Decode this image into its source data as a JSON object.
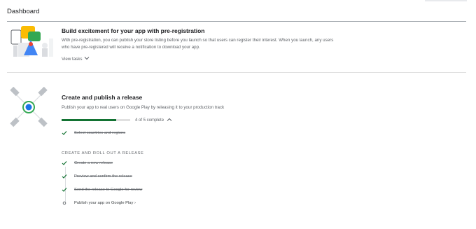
{
  "header": {
    "title": "Dashboard"
  },
  "cards": [
    {
      "title": "Build excitement for your app with pre-registration",
      "description": "With pre-registration, you can publish your store listing before you launch so that users can register their interest. When you launch, any users who have pre-registered will receive a notification to download your app.",
      "link_label": "View tasks"
    },
    {
      "title": "Create and publish a release",
      "description": "Publish your app to real users on Google Play by releasing it to your production track",
      "progress": {
        "completed": 4,
        "total": 5,
        "label": "4 of 5 complete"
      },
      "tasks_top": [
        {
          "label": "Select countries and regions",
          "done": true
        }
      ],
      "group_heading": "CREATE AND ROLL OUT A RELEASE",
      "tasks": [
        {
          "label": "Create a new release",
          "done": true
        },
        {
          "label": "Preview and confirm the release",
          "done": true
        },
        {
          "label": "Send the release to Google for review",
          "done": true
        },
        {
          "label": "Publish your app on Google Play ›",
          "done": false
        }
      ]
    }
  ],
  "colors": {
    "success": "#137333",
    "accent": "#1a73e8",
    "text": "#202124",
    "muted": "#5f6368"
  },
  "icons": [
    "chevron-down-icon",
    "chevron-up-icon",
    "check-icon",
    "circle-icon"
  ]
}
